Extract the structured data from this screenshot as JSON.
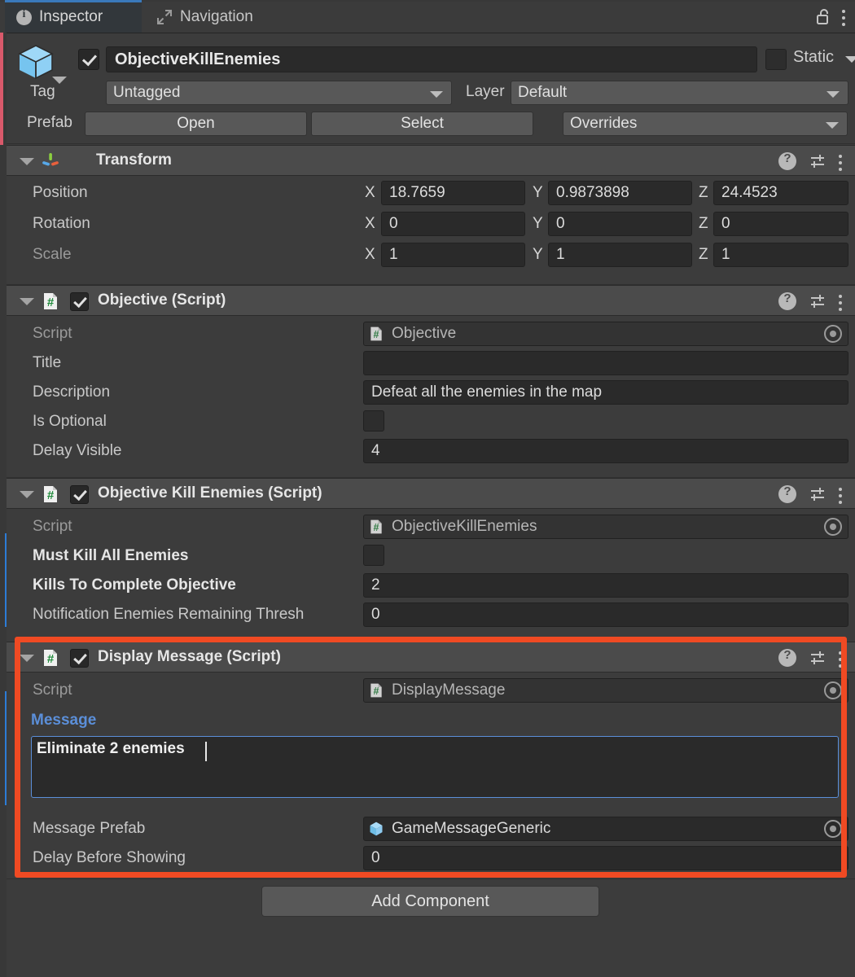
{
  "window": {
    "tabs": [
      {
        "label": "Inspector",
        "icon": "info-icon",
        "active": true
      },
      {
        "label": "Navigation",
        "icon": "navigation-icon",
        "active": false
      }
    ],
    "lock_icon": "unlocked-padlock-icon",
    "menu_icon": "kebab-menu-icon",
    "accent_color": "#3a79bb",
    "background_color": "#3c3c3c",
    "annotation_color": "#f04a23"
  },
  "gameobject": {
    "icon": "prefab-cube-icon",
    "enabled": true,
    "name": "ObjectiveKillEnemies",
    "static_label": "Static",
    "static_checked": false,
    "tag_label": "Tag",
    "tag_value": "Untagged",
    "layer_label": "Layer",
    "layer_value": "Default",
    "prefab_label": "Prefab",
    "prefab_open": "Open",
    "prefab_select": "Select",
    "prefab_overrides": "Overrides"
  },
  "components": [
    {
      "title": "Transform",
      "icon": "transform-axis-icon",
      "has_checkbox": false,
      "rows": [
        {
          "label": "Position",
          "bold": false,
          "axes": [
            "X",
            "Y",
            "Z"
          ],
          "values": [
            "18.7659",
            "0.9873898",
            "24.4523"
          ]
        },
        {
          "label": "Rotation",
          "bold": false,
          "axes": [
            "X",
            "Y",
            "Z"
          ],
          "values": [
            "0",
            "0",
            "0"
          ]
        },
        {
          "label": "Scale",
          "bold": false,
          "dim": true,
          "axes": [
            "X",
            "Y",
            "Z"
          ],
          "values": [
            "1",
            "1",
            "1"
          ]
        }
      ]
    },
    {
      "title": "Objective (Script)",
      "icon": "cs-script-icon",
      "has_checkbox": true,
      "enabled": true,
      "rows": [
        {
          "label": "Script",
          "type": "object",
          "value": "Objective",
          "readonly": true
        },
        {
          "label": "Title",
          "type": "text",
          "value": ""
        },
        {
          "label": "Description",
          "type": "text",
          "value": "Defeat all the enemies in the map"
        },
        {
          "label": "Is Optional",
          "type": "checkbox",
          "value": false
        },
        {
          "label": "Delay Visible",
          "type": "number",
          "value": "4"
        }
      ]
    },
    {
      "title": "Objective Kill Enemies (Script)",
      "icon": "cs-script-icon",
      "has_checkbox": true,
      "enabled": true,
      "rows": [
        {
          "label": "Script",
          "type": "object",
          "value": "ObjectiveKillEnemies",
          "readonly": true
        },
        {
          "label": "Must Kill All Enemies",
          "type": "checkbox",
          "value": false,
          "bold": true
        },
        {
          "label": "Kills To Complete Objective",
          "type": "number",
          "value": "2",
          "bold": true
        },
        {
          "label": "Notification Enemies Remaining Thresh",
          "type": "number",
          "value": "0"
        }
      ]
    },
    {
      "title": "Display Message (Script)",
      "icon": "cs-script-icon",
      "has_checkbox": true,
      "enabled": true,
      "highlighted": true,
      "rows": [
        {
          "label": "Script",
          "type": "object",
          "value": "DisplayMessage",
          "readonly": true
        },
        {
          "label": "Message",
          "type": "textarea",
          "value": "Eliminate 2 enemies",
          "focused": true
        },
        {
          "label": "Message Prefab",
          "type": "object",
          "value": "GameMessageGeneric",
          "icon": "prefab-cube-icon"
        },
        {
          "label": "Delay Before Showing",
          "type": "number",
          "value": "0"
        }
      ]
    }
  ],
  "footer": {
    "add_component_label": "Add Component"
  },
  "icons": {
    "help": "help-icon",
    "settings": "settings-sliders-icon",
    "menu": "kebab-menu-icon",
    "picker": "object-picker-icon"
  }
}
